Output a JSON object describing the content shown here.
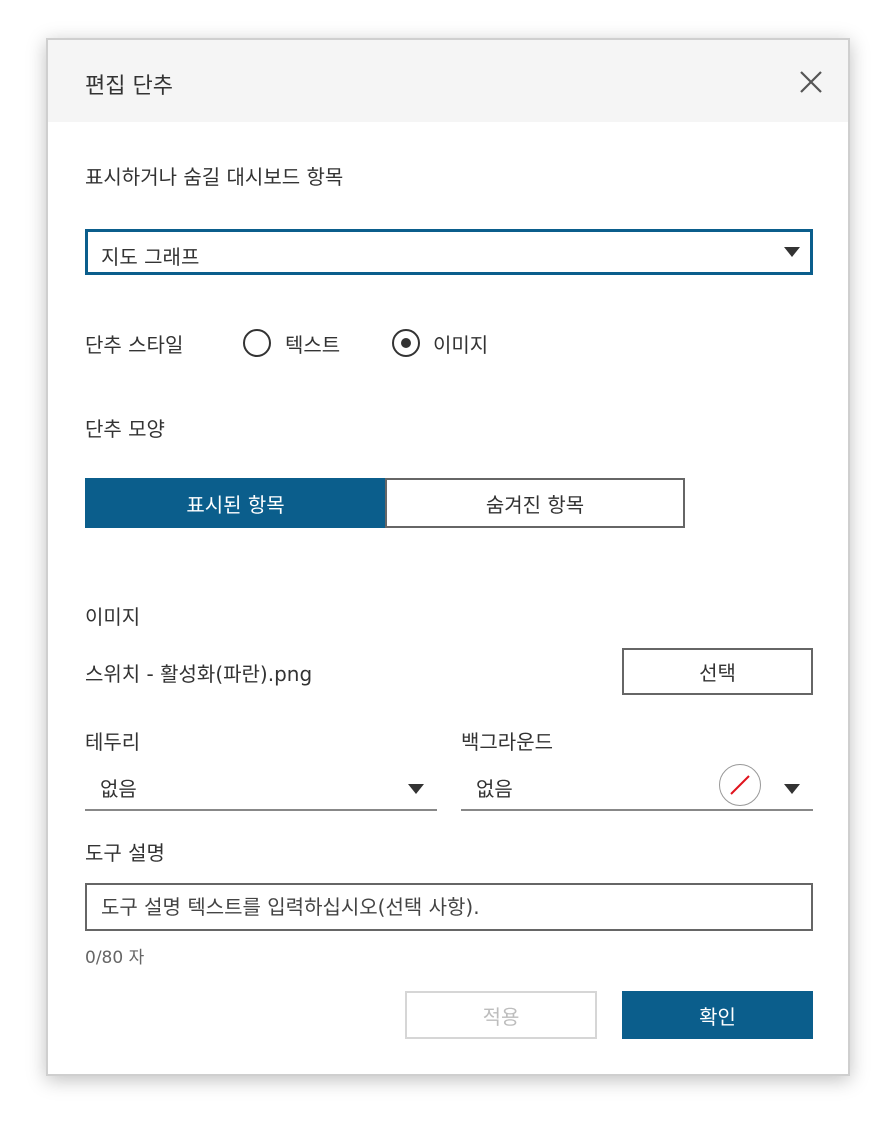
{
  "dialog": {
    "title": "편집 단추",
    "close_icon": "close-icon"
  },
  "dashboard_item": {
    "label": "표시하거나 숨길 대시보드 항목",
    "selected": "지도 그래프"
  },
  "button_style": {
    "label": "단추 스타일",
    "options": [
      {
        "label": "텍스트",
        "selected": false
      },
      {
        "label": "이미지",
        "selected": true
      }
    ]
  },
  "button_appearance": {
    "label": "단추 모양",
    "tabs": [
      {
        "label": "표시된 항목",
        "active": true
      },
      {
        "label": "숨겨진 항목",
        "active": false
      }
    ]
  },
  "image": {
    "label": "이미지",
    "filename": "스위치 - 활성화(파란).png",
    "select_button": "선택"
  },
  "border": {
    "label": "테두리",
    "value": "없음"
  },
  "background": {
    "label": "백그라운드",
    "value": "없음",
    "swatch_icon": "no-color-icon"
  },
  "tooltip": {
    "label": "도구 설명",
    "placeholder": "도구 설명 텍스트를 입력하십시오(선택 사항).",
    "value": "",
    "counter": "0/80 자"
  },
  "actions": {
    "apply": "적용",
    "ok": "확인"
  },
  "colors": {
    "primary": "#0b5e8c",
    "header_bg": "#f5f5f5",
    "no_color_slash": "#e0141e"
  }
}
